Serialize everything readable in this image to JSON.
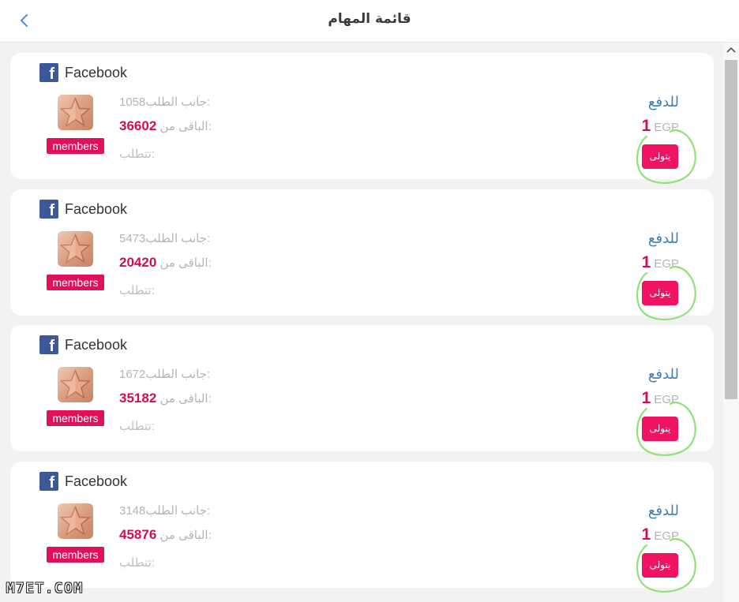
{
  "header": {
    "title": "قائمة المهام",
    "back_icon": "chevron-left-icon"
  },
  "tasks": [
    {
      "platform": "Facebook",
      "badge": "members",
      "requested_label": "جانب الطلب:",
      "requested_value": "1058",
      "remaining_label": "الباقى من:",
      "remaining_value": "36602",
      "required_label": "تتطلب:",
      "pay_label": "للدفع",
      "price_value": "1",
      "currency": "EGP",
      "action_label": "يتولى"
    },
    {
      "platform": "Facebook",
      "badge": "members",
      "requested_label": "جانب الطلب:",
      "requested_value": "5473",
      "remaining_label": "الباقى من:",
      "remaining_value": "20420",
      "required_label": "تتطلب:",
      "pay_label": "للدفع",
      "price_value": "1",
      "currency": "EGP",
      "action_label": "يتولى"
    },
    {
      "platform": "Facebook",
      "badge": "members",
      "requested_label": "جانب الطلب:",
      "requested_value": "1672",
      "remaining_label": "الباقى من:",
      "remaining_value": "35182",
      "required_label": "تتطلب:",
      "pay_label": "للدفع",
      "price_value": "1",
      "currency": "EGP",
      "action_label": "يتولى"
    },
    {
      "platform": "Facebook",
      "badge": "members",
      "requested_label": "جانب الطلب:",
      "requested_value": "3148",
      "remaining_label": "الباقى من:",
      "remaining_value": "45876",
      "required_label": "تتطلب:",
      "pay_label": "للدفع",
      "price_value": "1",
      "currency": "EGP",
      "action_label": "يتولى"
    }
  ],
  "watermark": "M7ET.COM",
  "colors": {
    "accent": "#f01361",
    "value_red": "#d0104e",
    "link_blue": "#3f7fb8",
    "facebook_blue": "#3b5998",
    "highlight_green": "#8fe27a"
  }
}
